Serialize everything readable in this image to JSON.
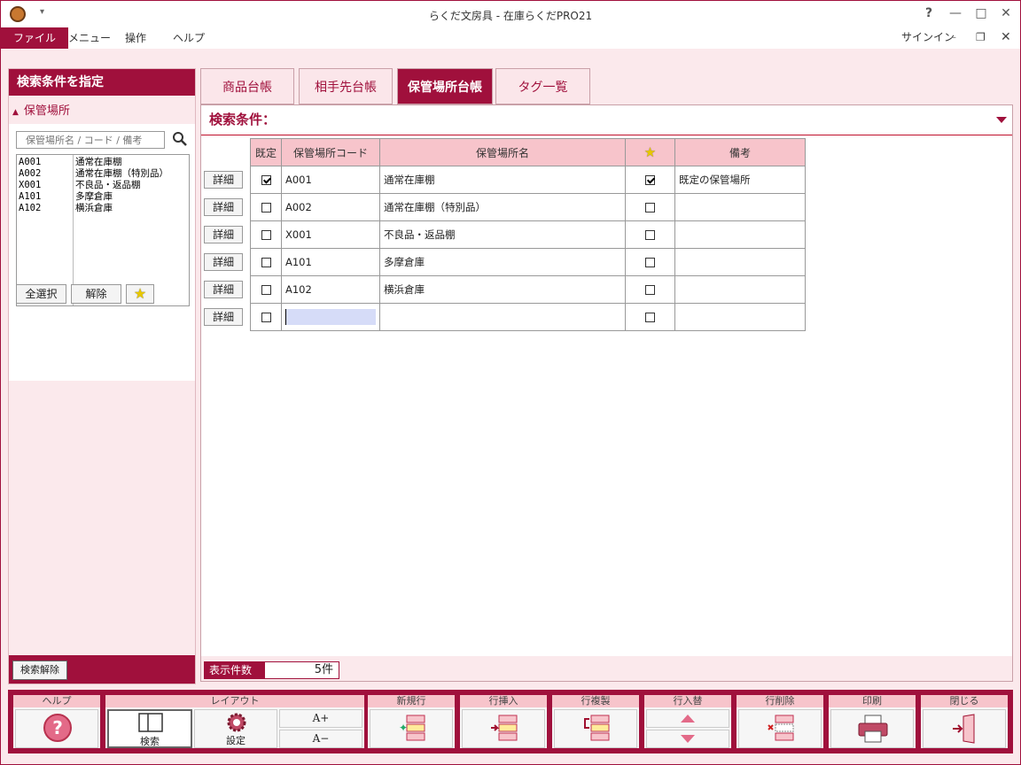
{
  "window": {
    "title": "らくだ文房具 - 在庫らくだPRO21",
    "controls": [
      "?",
      "—",
      "□",
      "✕"
    ]
  },
  "menu": {
    "items": [
      "ファイル",
      "メニュー",
      "操作",
      "ヘルプ"
    ],
    "signin": "サインイン"
  },
  "left_panel": {
    "header": "検索条件を指定",
    "section": "保管場所",
    "search_placeholder": "保管場所名 / コード / 備考",
    "list": [
      {
        "code": "A001",
        "name": "通常在庫棚"
      },
      {
        "code": "A002",
        "name": "通常在庫棚（特別品）"
      },
      {
        "code": "X001",
        "name": "不良品・返品棚"
      },
      {
        "code": "A101",
        "name": "多摩倉庫"
      },
      {
        "code": "A102",
        "name": "横浜倉庫"
      }
    ],
    "select_all": "全選択",
    "deselect": "解除",
    "clear_search": "検索解除"
  },
  "tabs": [
    "商品台帳",
    "相手先台帳",
    "保管場所台帳",
    "タグ一覧"
  ],
  "active_tab": 2,
  "search_condition": "検索条件：",
  "table": {
    "headers": [
      "既定",
      "保管場所コード",
      "保管場所名",
      "★",
      "備考"
    ],
    "detail_label": "詳細",
    "rows": [
      {
        "default": true,
        "code": "A001",
        "name": "通常在庫棚",
        "star": true,
        "note": "既定の保管場所"
      },
      {
        "default": false,
        "code": "A002",
        "name": "通常在庫棚（特別品）",
        "star": false,
        "note": ""
      },
      {
        "default": false,
        "code": "X001",
        "name": "不良品・返品棚",
        "star": false,
        "note": ""
      },
      {
        "default": false,
        "code": "A101",
        "name": "多摩倉庫",
        "star": false,
        "note": ""
      },
      {
        "default": false,
        "code": "A102",
        "name": "横浜倉庫",
        "star": false,
        "note": ""
      },
      {
        "default": false,
        "code": "",
        "name": "",
        "star": false,
        "note": ""
      }
    ]
  },
  "count": {
    "label": "表示件数",
    "value": "5件"
  },
  "toolbar": {
    "help": "ヘルプ",
    "layout": "レイアウト",
    "search": "検索",
    "settings": "設定",
    "font_up": "A+",
    "font_down": "A−",
    "new_row": "新規行",
    "insert_row": "行挿入",
    "copy_row": "行複製",
    "swap_row": "行入替",
    "delete_row": "行削除",
    "print": "印刷",
    "close": "閉じる"
  },
  "colors": {
    "accent": "#a0103c",
    "header_pink": "#f7c4cb",
    "bg_pink": "#fbe9ec"
  }
}
